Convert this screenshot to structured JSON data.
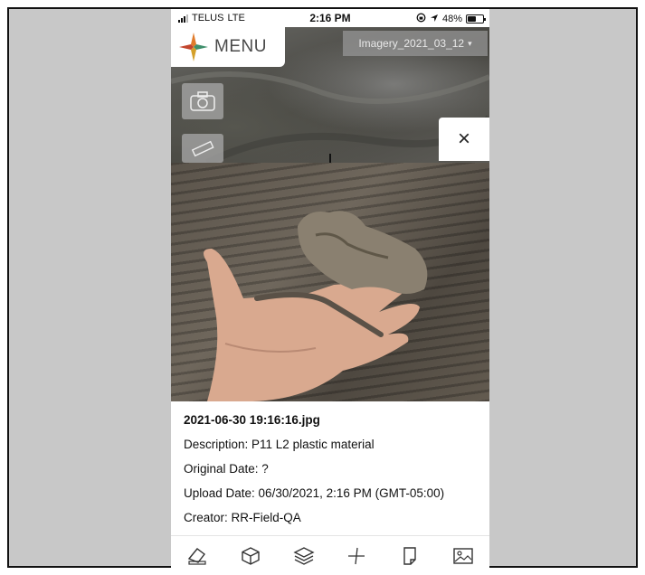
{
  "status_bar": {
    "carrier": "TELUS",
    "network": "LTE",
    "time": "2:16 PM",
    "battery": "48%",
    "battery_level": 0.48
  },
  "header": {
    "menu_label": "MENU",
    "logo_icon": "compass-star-icon",
    "imagery_selected": "Imagery_2021_03_12"
  },
  "map_controls": {
    "camera_icon": "camera-icon",
    "measure_icon": "ruler-icon",
    "close_label": "×"
  },
  "photo_info": {
    "filename": "2021-06-30 19:16:16.jpg",
    "description": "Description: P11 L2 plastic material",
    "original_date": "Original Date: ?",
    "upload_date": "Upload Date: 06/30/2021, 2:16 PM (GMT-05:00)",
    "creator": "Creator: RR-Field-QA"
  },
  "toolbar": {
    "items": [
      {
        "icon": "eraser-icon"
      },
      {
        "icon": "cube-icon"
      },
      {
        "icon": "layers-icon"
      },
      {
        "icon": "crosshair-icon"
      },
      {
        "icon": "note-icon"
      },
      {
        "icon": "image-icon"
      }
    ]
  }
}
